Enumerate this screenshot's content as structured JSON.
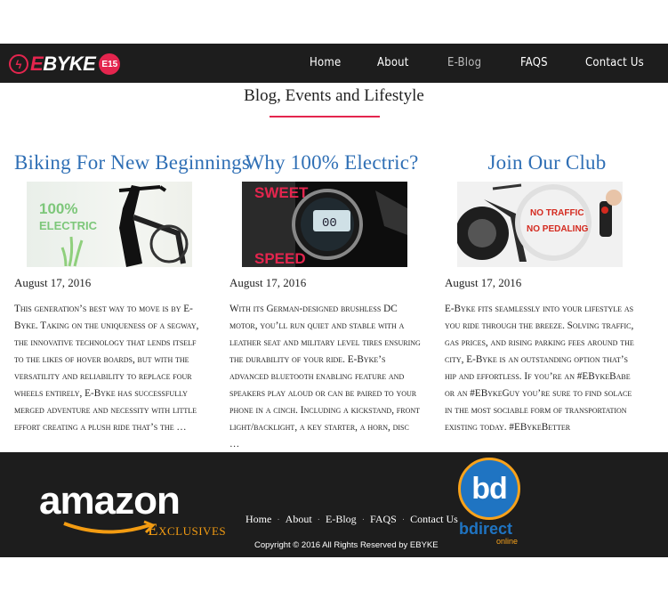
{
  "header": {
    "logo": {
      "e": "E",
      "byke": "BYKE",
      "badge": "E15"
    },
    "nav": [
      {
        "label": "Home",
        "active": false
      },
      {
        "label": "About",
        "active": false
      },
      {
        "label": "E-Blog",
        "active": true
      },
      {
        "label": "FAQS",
        "active": false
      },
      {
        "label": "Contact Us",
        "active": false
      }
    ]
  },
  "main": {
    "title": "Blog, Events and Lifestyle",
    "posts": [
      {
        "title": "Biking For New Beginnings",
        "image_text": "100%\nELECTRIC",
        "date": "August 17, 2016",
        "excerpt": "This generation’s best way to move is by E-Byke. Taking on the uniqueness of a segway, the innovative technology that lends itself to the likes of hover boards, but with the versatility and reliability to replace four wheels entirely, E-Byke has successfully merged adventure and necessity with little effort creating a plush ride that’s the …"
      },
      {
        "title": "Why 100% Electric?",
        "image_text_top": "SWEET",
        "image_text_bottom": "SPEED",
        "image_display": "00",
        "date": "August 17, 2016",
        "excerpt": "With its German-designed brushless DC motor, you’ll run quiet and stable with a leather seat and military level tires ensuring the durability of your ride. E-Byke’s advanced bluetooth enabling feature and speakers play aloud or can be paired to your phone in a cinch. Including a kickstand, front light/backlight, a key starter, a horn, disc …"
      },
      {
        "title": "Join Our Club",
        "image_text_1": "NO TRAFFIC",
        "image_text_2": "NO PEDALING",
        "date": "August 17, 2016",
        "excerpt": "E-Byke fits seamlessly into your lifestyle as you ride through the breeze. Solving traffic, gas prices, and rising parking fees around the city, E-Byke is an outstanding option that’s hip and effortless. If you’re an #EBykeBabe or an #EBykeGuy you’re sure to find solace in the most sociable form of transportation existing today. #EBykeBetter"
      }
    ]
  },
  "footer": {
    "amazon": "amazon",
    "amazon_sub": "Exclusives",
    "nav": [
      "Home",
      "About",
      "E-Blog",
      "FAQS",
      "Contact Us"
    ],
    "copyright": "Copyright © 2016 All Rights Reserved by EBYKE",
    "bdirect": {
      "mark": "bd",
      "name": "bdirect",
      "sub": "online"
    }
  },
  "colors": {
    "accent": "#e4254e",
    "title_blue": "#2f6fb5",
    "bar": "#1d1d1d",
    "amazon_orange": "#f39c12"
  }
}
